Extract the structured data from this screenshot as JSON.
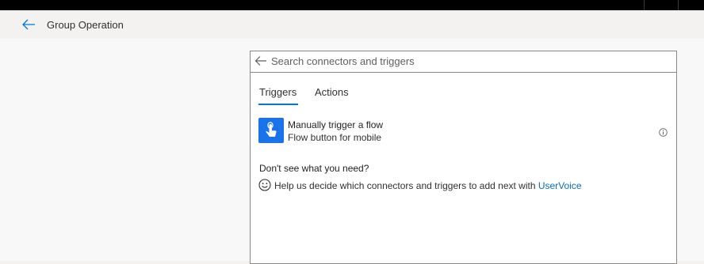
{
  "header": {
    "title": "Group Operation",
    "back_icon": "back-arrow-icon"
  },
  "search": {
    "placeholder": "Search connectors and triggers",
    "value": "",
    "back_icon": "back-arrow-icon"
  },
  "tabs": [
    {
      "label": "Triggers",
      "selected": true
    },
    {
      "label": "Actions",
      "selected": false
    }
  ],
  "triggers": [
    {
      "title": "Manually trigger a flow",
      "subtitle": "Flow button for mobile",
      "icon": "hand-tap-icon",
      "info_icon": "info-icon"
    }
  ],
  "help": {
    "heading": "Don't see what you need?",
    "text": "Help us decide which connectors and triggers to add next with ",
    "link": "UserVoice",
    "icon": "smiley-icon"
  },
  "colors": {
    "accent": "#0078d4",
    "icon_background": "#1a73e8",
    "link": "#0b6cbd",
    "top_bar": "#000000"
  }
}
